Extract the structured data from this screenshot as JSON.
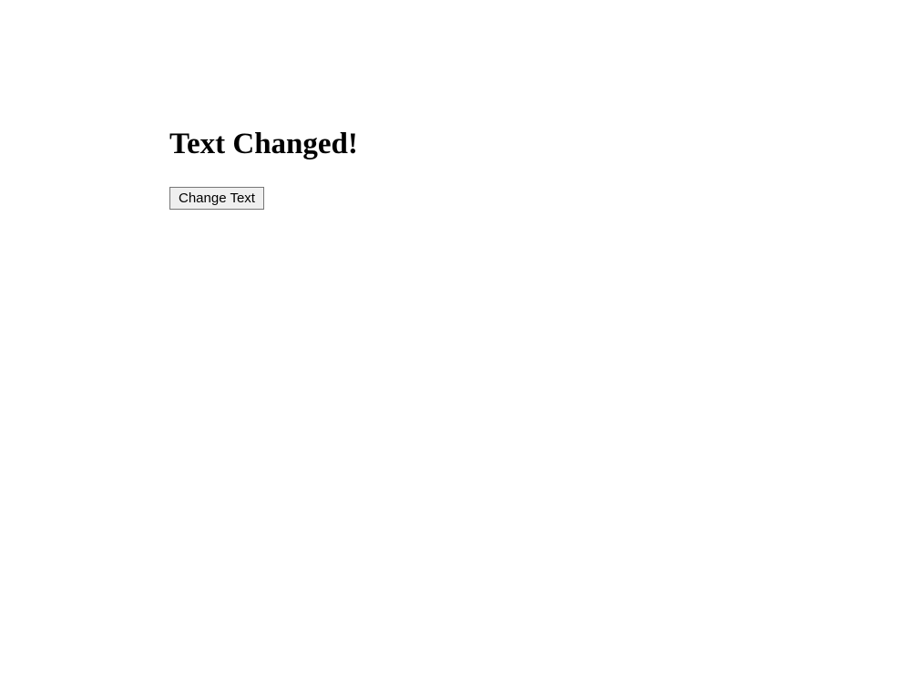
{
  "heading": {
    "text": "Text Changed!"
  },
  "button": {
    "label": "Change Text"
  }
}
